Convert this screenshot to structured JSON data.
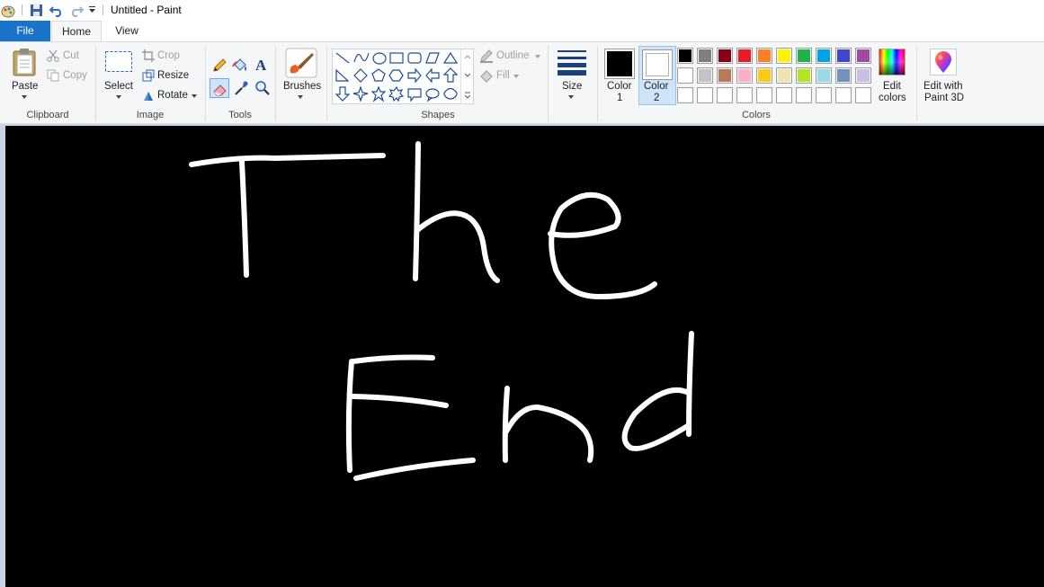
{
  "window": {
    "title": "Untitled - Paint"
  },
  "quick_access": {
    "icons": [
      "paint-app-icon",
      "save-icon",
      "undo-icon",
      "redo-icon",
      "customize-dropdown-icon"
    ]
  },
  "tabs": [
    {
      "label": "File"
    },
    {
      "label": "Home",
      "active": true
    },
    {
      "label": "View"
    }
  ],
  "ribbon": {
    "clipboard": {
      "label": "Clipboard",
      "paste": "Paste",
      "cut": "Cut",
      "copy": "Copy"
    },
    "image": {
      "label": "Image",
      "select": "Select",
      "crop": "Crop",
      "resize": "Resize",
      "rotate": "Rotate"
    },
    "tools": {
      "label": "Tools",
      "items": [
        "pencil-icon",
        "fill-icon",
        "text-icon",
        "eraser-icon",
        "color-picker-icon",
        "magnifier-icon"
      ],
      "selected": "eraser-icon"
    },
    "brushes": {
      "label": "Brushes"
    },
    "shapes": {
      "label": "Shapes",
      "outline": "Outline",
      "fill": "Fill"
    },
    "size": {
      "label": "Size"
    },
    "colors": {
      "label": "Colors",
      "color1": {
        "label": "Color",
        "index": "1",
        "value": "#000000"
      },
      "color2": {
        "label": "Color",
        "index": "2",
        "value": "#ffffff"
      },
      "palette_row1": [
        "#000000",
        "#7f7f7f",
        "#880015",
        "#ed1c24",
        "#ff7f27",
        "#fff200",
        "#22b14c",
        "#00a2e8",
        "#3f48cc",
        "#a349a4"
      ],
      "palette_row2": [
        "#ffffff",
        "#c3c3c3",
        "#b97a57",
        "#ffaec9",
        "#ffc90e",
        "#efe4b0",
        "#b5e61d",
        "#99d9ea",
        "#7092be",
        "#c8bfe7"
      ],
      "palette_row3": [
        "#ffffff",
        "#ffffff",
        "#ffffff",
        "#ffffff",
        "#ffffff",
        "#ffffff",
        "#ffffff",
        "#ffffff",
        "#ffffff",
        "#ffffff"
      ],
      "edit_colors_line1": "Edit",
      "edit_colors_line2": "colors"
    },
    "paint3d": {
      "line1": "Edit with",
      "line2": "Paint 3D"
    }
  },
  "canvas": {
    "background": "#000000",
    "stroke_color": "#ffffff",
    "drawn_text_line1": "The",
    "drawn_text_line2": "End"
  }
}
